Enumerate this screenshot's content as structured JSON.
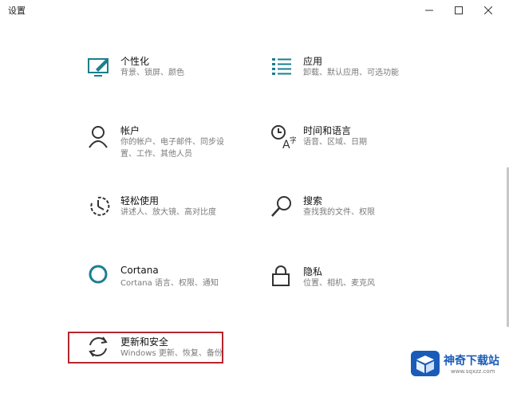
{
  "window": {
    "title": "设置"
  },
  "items": [
    {
      "name": "个性化",
      "desc": [
        "背景、锁屏、颜色"
      ],
      "icon": "personalization-icon"
    },
    {
      "name": "应用",
      "desc": [
        "卸载、默认应用、可选功能"
      ],
      "icon": "apps-icon"
    },
    {
      "name": "帐户",
      "desc": [
        "你的帐户、电子邮件、同步设",
        "置、工作、其他人员"
      ],
      "icon": "account-icon"
    },
    {
      "name": "时间和语言",
      "desc": [
        "语音、区域、日期"
      ],
      "icon": "time-language-icon"
    },
    {
      "name": "轻松使用",
      "desc": [
        "讲述人、放大镜、高对比度"
      ],
      "icon": "ease-of-access-icon"
    },
    {
      "name": "搜索",
      "desc": [
        "查找我的文件、权限"
      ],
      "icon": "search-icon"
    },
    {
      "name": "Cortana",
      "desc": [
        "Cortana 语言、权限、通知"
      ],
      "icon": "cortana-icon"
    },
    {
      "name": "隐私",
      "desc": [
        "位置、相机、麦克风"
      ],
      "icon": "lock-icon"
    },
    {
      "name": "更新和安全",
      "desc": [
        "Windows 更新、恢复、备份"
      ],
      "icon": "update-sync-icon"
    }
  ],
  "watermark": {
    "text": "神奇下载站",
    "url": "www.sqxzz.com"
  },
  "colors": {
    "accent": "#1a7f8e",
    "highlight_border": "#b5262d"
  }
}
